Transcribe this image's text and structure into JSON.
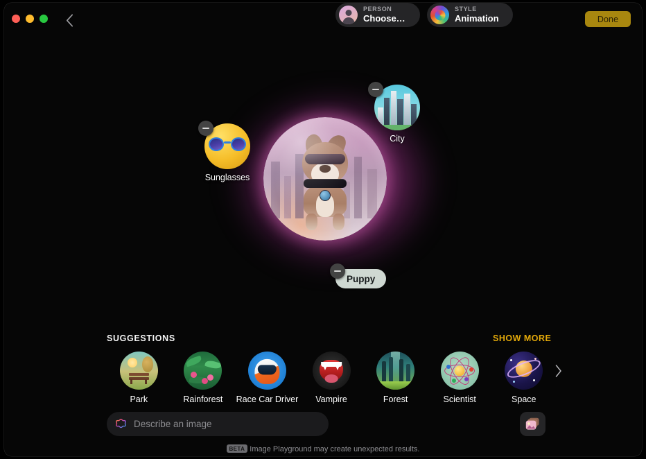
{
  "window": {
    "traffic_lights": [
      "close",
      "minimize",
      "zoom"
    ],
    "back_label": "Back",
    "done_label": "Done",
    "done_color": "#a8870f"
  },
  "canvas": {
    "main_image": {
      "name": "generated-puppy-image",
      "description": "Cartoon puppy wearing sunglasses and a collar in front of a city skyline",
      "glow_color": "#ff6ed2"
    },
    "concepts": [
      {
        "label": "Sunglasses",
        "icon": "sunglasses-emoji",
        "remove_label": "Remove Sunglasses"
      },
      {
        "label": "City",
        "icon": "city-skyline",
        "remove_label": "Remove City"
      },
      {
        "label": "Puppy",
        "icon": "text-chip",
        "remove_label": "Remove Puppy"
      }
    ]
  },
  "suggestions": {
    "heading": "SUGGESTIONS",
    "show_more_label": "SHOW MORE",
    "show_more_color": "#e3a90a",
    "next_label": "Next",
    "items": [
      {
        "label": "Park",
        "art": "park-bench"
      },
      {
        "label": "Rainforest",
        "art": "rainforest-foliage"
      },
      {
        "label": "Race Car Driver",
        "art": "racing-helmet"
      },
      {
        "label": "Vampire",
        "art": "vampire-mouth"
      },
      {
        "label": "Forest",
        "art": "forest-trees"
      },
      {
        "label": "Scientist",
        "art": "atom"
      },
      {
        "label": "Space",
        "art": "ringed-planet"
      }
    ]
  },
  "bottom_bar": {
    "prompt": {
      "placeholder": "Describe an image",
      "value": "",
      "icon": "apple-intelligence-icon"
    },
    "person": {
      "caption": "PERSON",
      "value": "Choose…",
      "icon": "person-avatar-icon"
    },
    "style": {
      "caption": "STYLE",
      "value": "Animation",
      "icon": "color-wheel-icon"
    },
    "photo_button": {
      "label": "Photos",
      "icon": "photo-stack-icon"
    },
    "disclaimer": {
      "badge": "BETA",
      "text": "Image Playground may create unexpected results."
    }
  }
}
